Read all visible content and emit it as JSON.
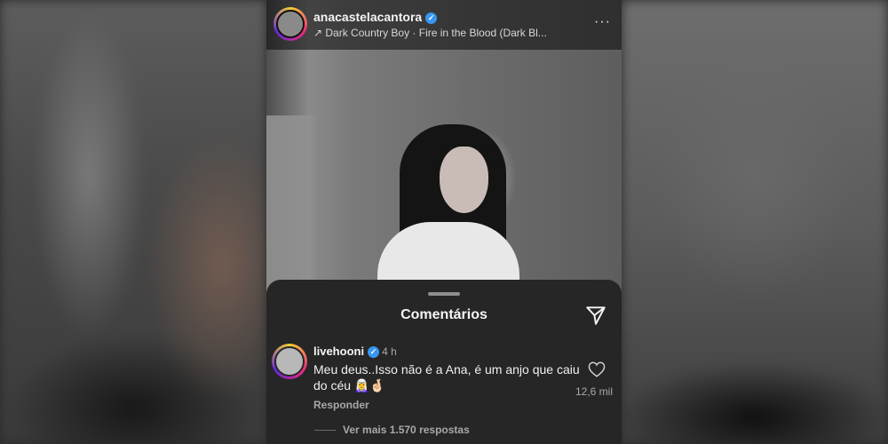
{
  "post": {
    "username": "anacastelacantora",
    "verified_icon": "verified-badge-icon",
    "song": "↗ Dark Country Boy · Fire in the Blood (Dark Bl...",
    "more_icon": "···"
  },
  "comments": {
    "title": "Comentários",
    "share_icon": "send-icon",
    "items": [
      {
        "username": "livehooni",
        "time": "4 h",
        "text": "Meu deus..Isso não é a Ana, é um anjo que caiu do céu 🧝‍♀️🤞🏻",
        "reply_label": "Responder",
        "likes": "12,6 mil",
        "more_replies": "Ver mais 1.570 respostas"
      }
    ]
  },
  "colors": {
    "sheet_bg": "#262626",
    "verified": "#3897f0",
    "muted_text": "#a8a8a8"
  }
}
